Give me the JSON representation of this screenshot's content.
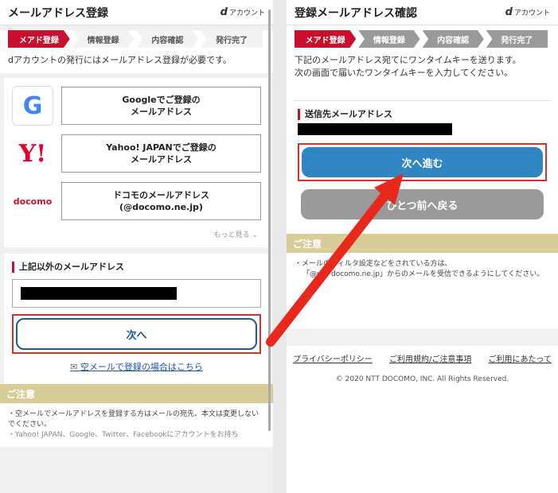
{
  "left": {
    "title": "メールアドレス登録",
    "brand_mark": "d",
    "brand_text": "アカウント",
    "steps": [
      "メアド登録",
      "情報登録",
      "内容確認",
      "発行完了"
    ],
    "intro": "dアカウントの発行にはメールアドレス登録が必要です。",
    "providers": [
      {
        "logo": "google-logo",
        "label_line1": "Googleでご登録の",
        "label_line2": "メールアドレス"
      },
      {
        "logo": "yahoo-logo",
        "label_line1": "Yahoo! JAPANでご登録の",
        "label_line2": "メールアドレス"
      },
      {
        "logo": "docomo-logo",
        "logo_text": "docomo",
        "label_line1": "ドコモのメールアドレス",
        "label_line2": "(@docomo.ne.jp)"
      }
    ],
    "more": "もっと見る",
    "other_title": "上記以外のメールアドレス",
    "next_label": "次へ",
    "karamail": "空メールで登録の場合はこちら",
    "notice_title": "ご注意",
    "notice_lines": [
      "・空メールでメールアドレスを登録する方はメールの宛先、本文は変更しないでください。",
      "・Yahoo! JAPAN、Google、Twitter、Facebookにアカウントをお持ち"
    ]
  },
  "right": {
    "title": "登録メールアドレス確認",
    "brand_mark": "d",
    "brand_text": "アカウント",
    "steps": [
      "メアド登録",
      "情報登録",
      "内容確認",
      "発行完了"
    ],
    "intro_line1": "下記のメールアドレス宛てにワンタイムキーを送ります。",
    "intro_line2": "次の画面で届いたワンタイムキーを入力してください。",
    "sent_title": "送信先メールアドレス",
    "next_label": "次へ進む",
    "back_label": "ひとつ前へ戻る",
    "notice_title": "ご注意",
    "notice_line1": "・メールのフィルタ設定などをされている方は、",
    "notice_line2": "「@w... docomo.ne.jp」からのメールを受信できるようにしてください。",
    "footer_links": [
      "プライバシーポリシー",
      "ご利用規約/ご注意事項",
      "ご利用にあたって"
    ],
    "copyright": "© 2020 NTT DOCOMO, INC. All Rights Reserved."
  },
  "colors": {
    "accent_red": "#c8102e",
    "button_blue": "#2f86c3",
    "highlight_red": "#d93025",
    "arrow_red": "#e8281c",
    "notice_gold": "#d8cc98"
  }
}
